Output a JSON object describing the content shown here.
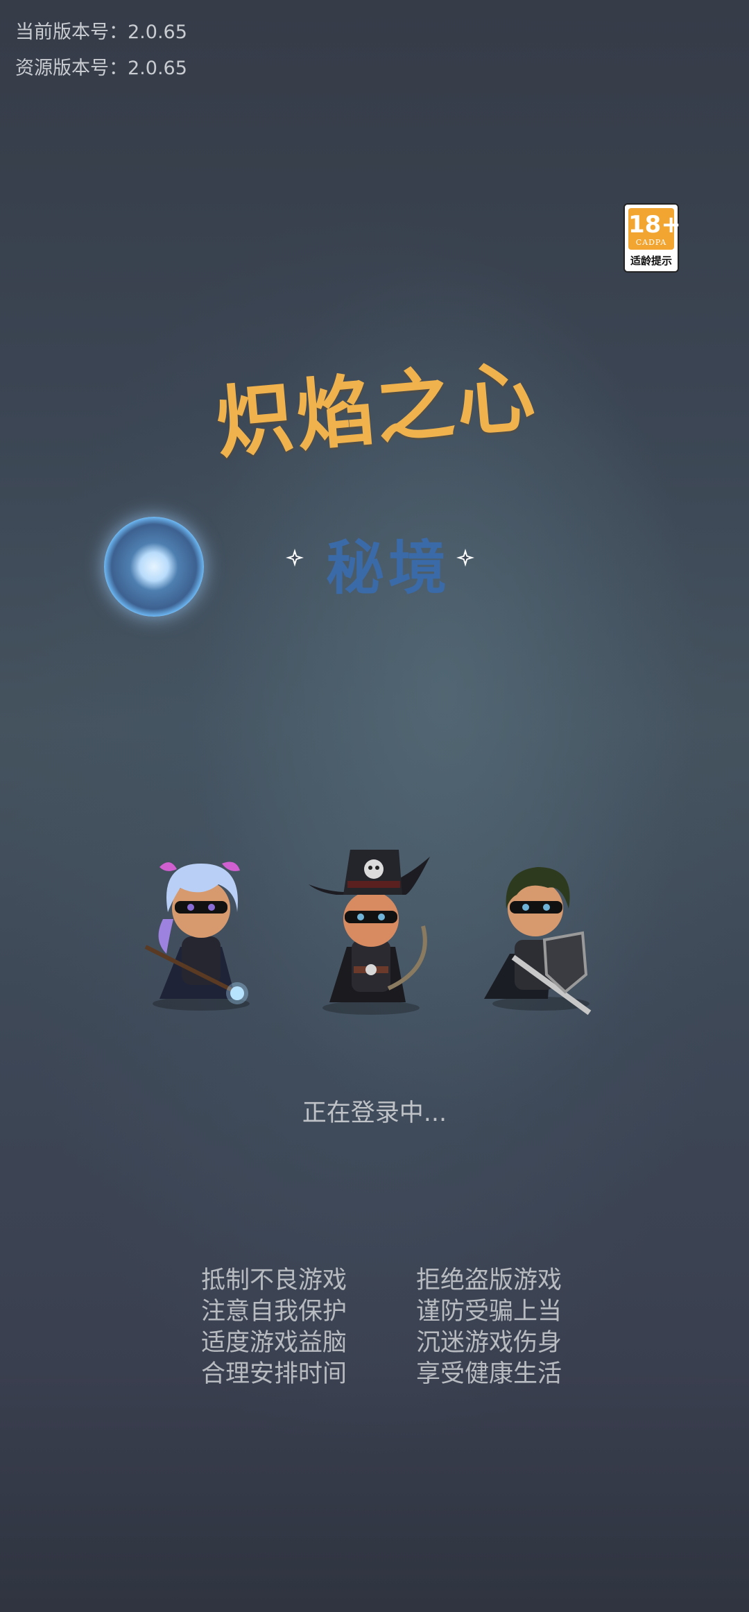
{
  "version": {
    "current": "当前版本号：2.0.65",
    "resource": "资源版本号：2.0.65"
  },
  "age_rating": {
    "age": "18+",
    "org": "CADPA",
    "tip": "适龄提示"
  },
  "title": "炽焰之心",
  "subtitle": "秘境",
  "status": "正在登录中...",
  "health_notice": [
    [
      "抵制不良游戏",
      "拒绝盗版游戏"
    ],
    [
      "注意自我保护",
      "谨防受骗上当"
    ],
    [
      "适度游戏益脑",
      "沉迷游戏伤身"
    ],
    [
      "合理安排时间",
      "享受健康生活"
    ]
  ],
  "colors": {
    "title": "#f0b24c",
    "subtitle": "#3a6aa8",
    "badge": "#f2a531"
  },
  "icons": {
    "age_badge": "age-18-rating-icon",
    "orb": "glowing-orb-icon",
    "sparkle": "sparkle-icon",
    "heroes": [
      "mage-hero-icon",
      "archer-hero-icon",
      "knight-hero-icon"
    ]
  }
}
